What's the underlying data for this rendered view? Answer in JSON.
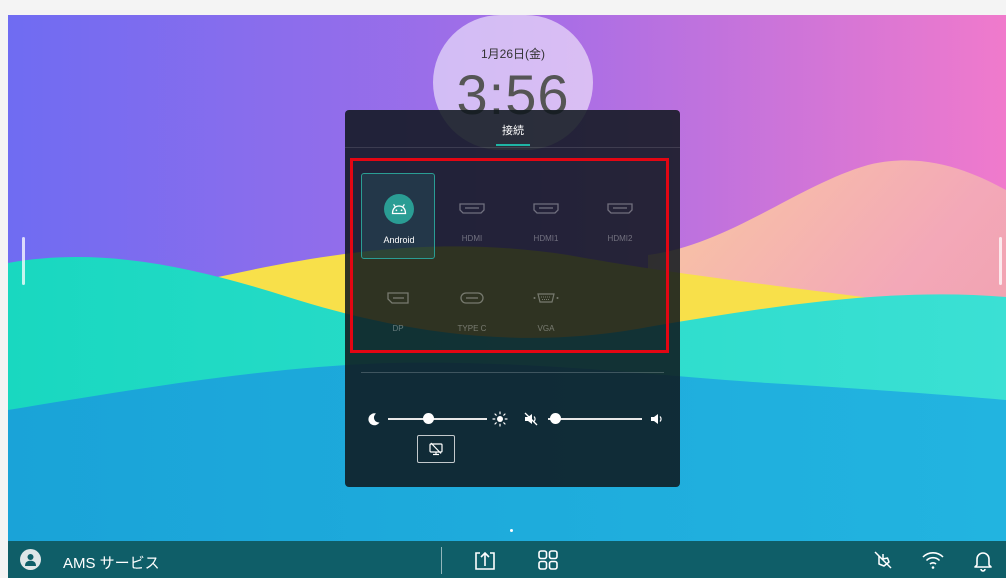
{
  "clock": {
    "date": "1月26日(金)",
    "time": "3:56"
  },
  "panel": {
    "tab_label": "接続",
    "sources": [
      {
        "label": "Android",
        "icon": "android-icon",
        "selected": true
      },
      {
        "label": "HDMI",
        "icon": "hdmi-port-icon",
        "selected": false
      },
      {
        "label": "HDMI1",
        "icon": "hdmi-port-icon",
        "selected": false
      },
      {
        "label": "HDMI2",
        "icon": "hdmi-port-icon",
        "selected": false
      },
      {
        "label": "DP",
        "icon": "displayport-icon",
        "selected": false
      },
      {
        "label": "TYPE C",
        "icon": "usb-c-port-icon",
        "selected": false
      },
      {
        "label": "VGA",
        "icon": "vga-port-icon",
        "selected": false
      }
    ],
    "brightness": {
      "level": 0.41
    },
    "volume": {
      "level": 0.08,
      "muted": true
    }
  },
  "taskbar": {
    "user_label": "AMS サービス",
    "icons": [
      "cast-screen-icon",
      "apps-grid-icon",
      "touch-mute-icon",
      "wifi-icon",
      "bell-icon"
    ]
  },
  "colors": {
    "accent": "#1fb5a5",
    "taskbar": "#0f5e68",
    "highlight": "#e30613"
  }
}
